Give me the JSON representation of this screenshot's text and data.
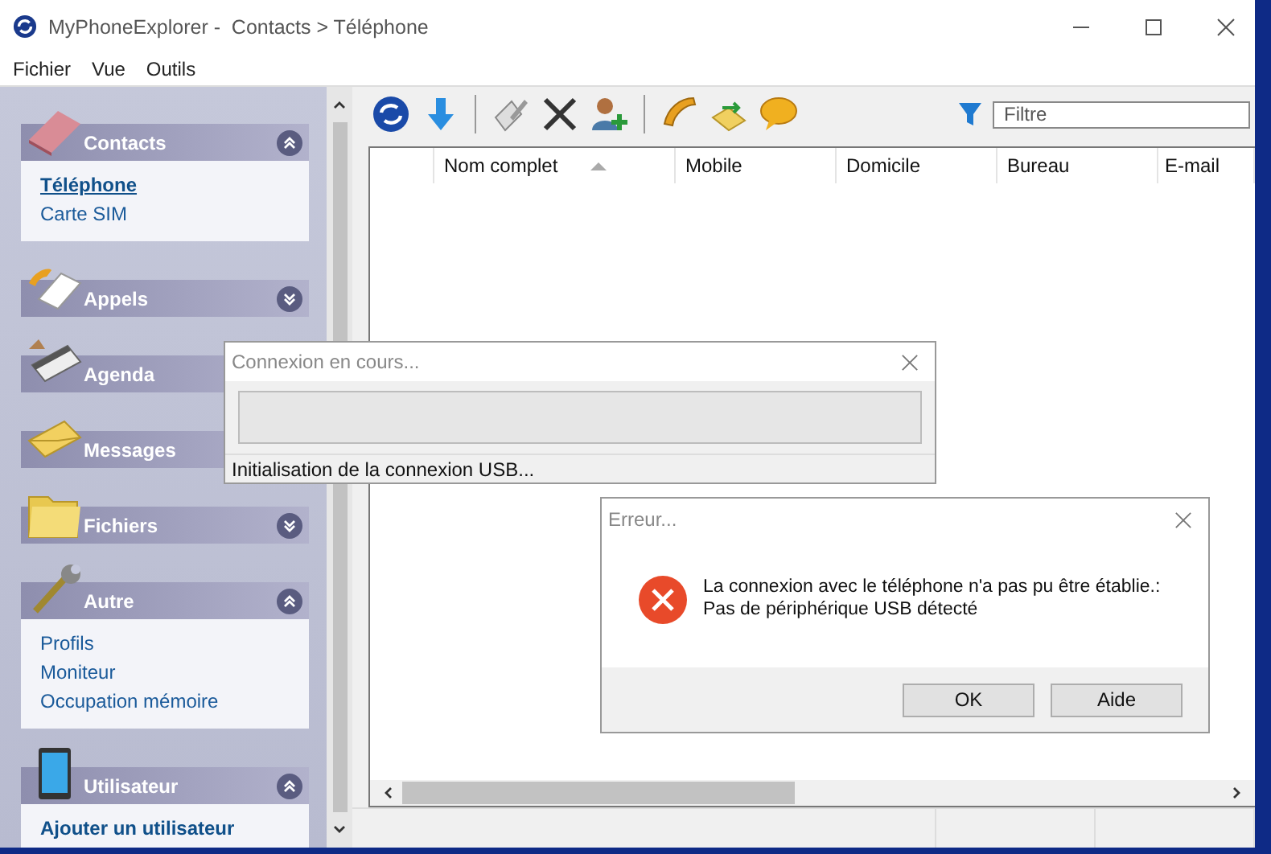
{
  "window": {
    "title": "MyPhoneExplorer -  Contacts > Téléphone"
  },
  "menu": [
    {
      "label": "Fichier"
    },
    {
      "label": "Vue"
    },
    {
      "label": "Outils"
    }
  ],
  "sidebar": {
    "groups": [
      {
        "title": "Contacts",
        "kind": "book",
        "expanded": true,
        "items": [
          {
            "label": "Téléphone",
            "selected": true,
            "bold": true
          },
          {
            "label": "Carte SIM",
            "selected": false,
            "bold": false
          }
        ]
      },
      {
        "title": "Appels",
        "kind": "calls",
        "expanded": false
      },
      {
        "title": "Agenda",
        "kind": "calendar"
      },
      {
        "title": "Messages",
        "kind": "envelope"
      },
      {
        "title": "Fichiers",
        "kind": "folder",
        "expanded": false
      },
      {
        "title": "Autre",
        "kind": "wrench",
        "expanded": true,
        "items": [
          {
            "label": "Profils",
            "selected": false,
            "bold": false
          },
          {
            "label": "Moniteur",
            "selected": false,
            "bold": false
          },
          {
            "label": "Occupation mémoire",
            "selected": false,
            "bold": false
          }
        ]
      },
      {
        "title": "Utilisateur",
        "kind": "device",
        "expanded": true,
        "items": [
          {
            "label": "Ajouter un utilisateur",
            "selected": false,
            "bold": true
          }
        ]
      }
    ]
  },
  "toolbar": {
    "buttons": [
      {
        "kind": "refresh"
      },
      {
        "kind": "download"
      },
      {
        "kind": "separator"
      },
      {
        "kind": "edit"
      },
      {
        "kind": "delete"
      },
      {
        "kind": "add-contact"
      },
      {
        "kind": "separator"
      },
      {
        "kind": "call"
      },
      {
        "kind": "sync"
      },
      {
        "kind": "message"
      }
    ],
    "filter": {
      "placeholder": "Filtre"
    }
  },
  "table": {
    "columns": [
      {
        "label": "Nom complet",
        "sorted": true
      },
      {
        "label": "Mobile",
        "sorted": false
      },
      {
        "label": "Domicile",
        "sorted": false
      },
      {
        "label": "Bureau",
        "sorted": false
      },
      {
        "label": "E-mail",
        "sorted": false
      }
    ]
  },
  "progress_dialog": {
    "title": "Connexion en cours...",
    "level": 0,
    "status": "Initialisation de la connexion USB..."
  },
  "error_dialog": {
    "title": "Erreur...",
    "message": "La connexion avec le téléphone n'a pas pu être établie.:\nPas de périphérique USB détecté",
    "buttons": [
      {
        "label": "OK"
      },
      {
        "label": "Aide"
      }
    ]
  }
}
